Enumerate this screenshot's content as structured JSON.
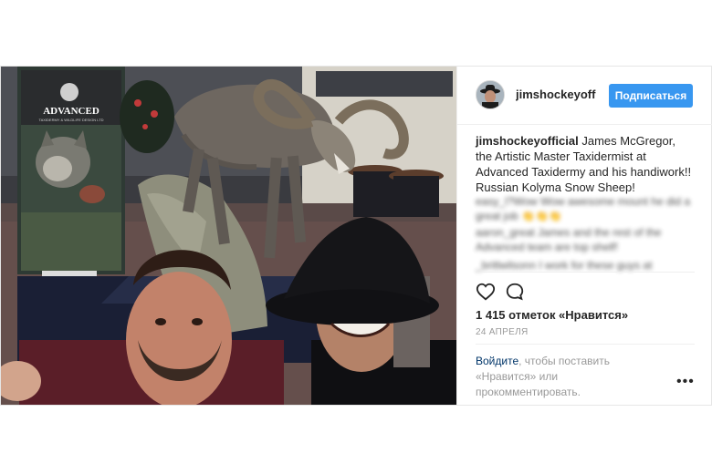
{
  "post": {
    "user": {
      "name": "jimshockeyofficial",
      "name_short": "jimshockeyoffic"
    },
    "follow_label": "Подписаться",
    "caption": "James McGregor, the Artistic Master Taxidermist at Advanced Taxidermy and his handiwork!! Russian Kolyma Snow Sheep!",
    "comments": [
      "easy_l?Wow Wow awesome mount he did a great job 👏👏👏",
      "aaron_great James and the rest of the Advanced team are top shelf!",
      "_britlwilsonn I work for these guys at"
    ],
    "likes": "1 415 отметок «Нравится»",
    "date": "24 АПРЕЛЯ",
    "login_link": "Войдите",
    "login_text": ", чтобы поставить «Нравится» или прокомментировать.",
    "more_icon": "•••",
    "banner_text": "ADVANCED",
    "banner_subtext": "TAXIDERMY & WILDLIFE DESIGN LTD"
  },
  "colors": {
    "accent": "#3897f0",
    "link": "#003569",
    "muted": "#999999",
    "text": "#262626"
  }
}
